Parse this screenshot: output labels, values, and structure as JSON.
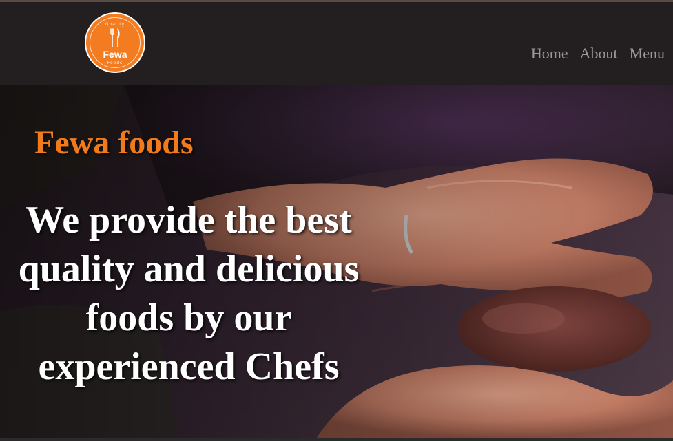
{
  "header": {
    "logo": {
      "top_text": "Quality",
      "name": "Fewa",
      "bottom_text": "Foods",
      "icon": "fork-knife-icon",
      "color": "#f47c20"
    },
    "nav": [
      {
        "label": "Home"
      },
      {
        "label": "About"
      },
      {
        "label": "Menu"
      }
    ]
  },
  "hero": {
    "brand": "Fewa foods",
    "brand_color": "#f07b1d",
    "tagline_lines": [
      "We provide the best",
      "quality and delicious",
      "foods by our",
      "experienced Chefs"
    ]
  }
}
